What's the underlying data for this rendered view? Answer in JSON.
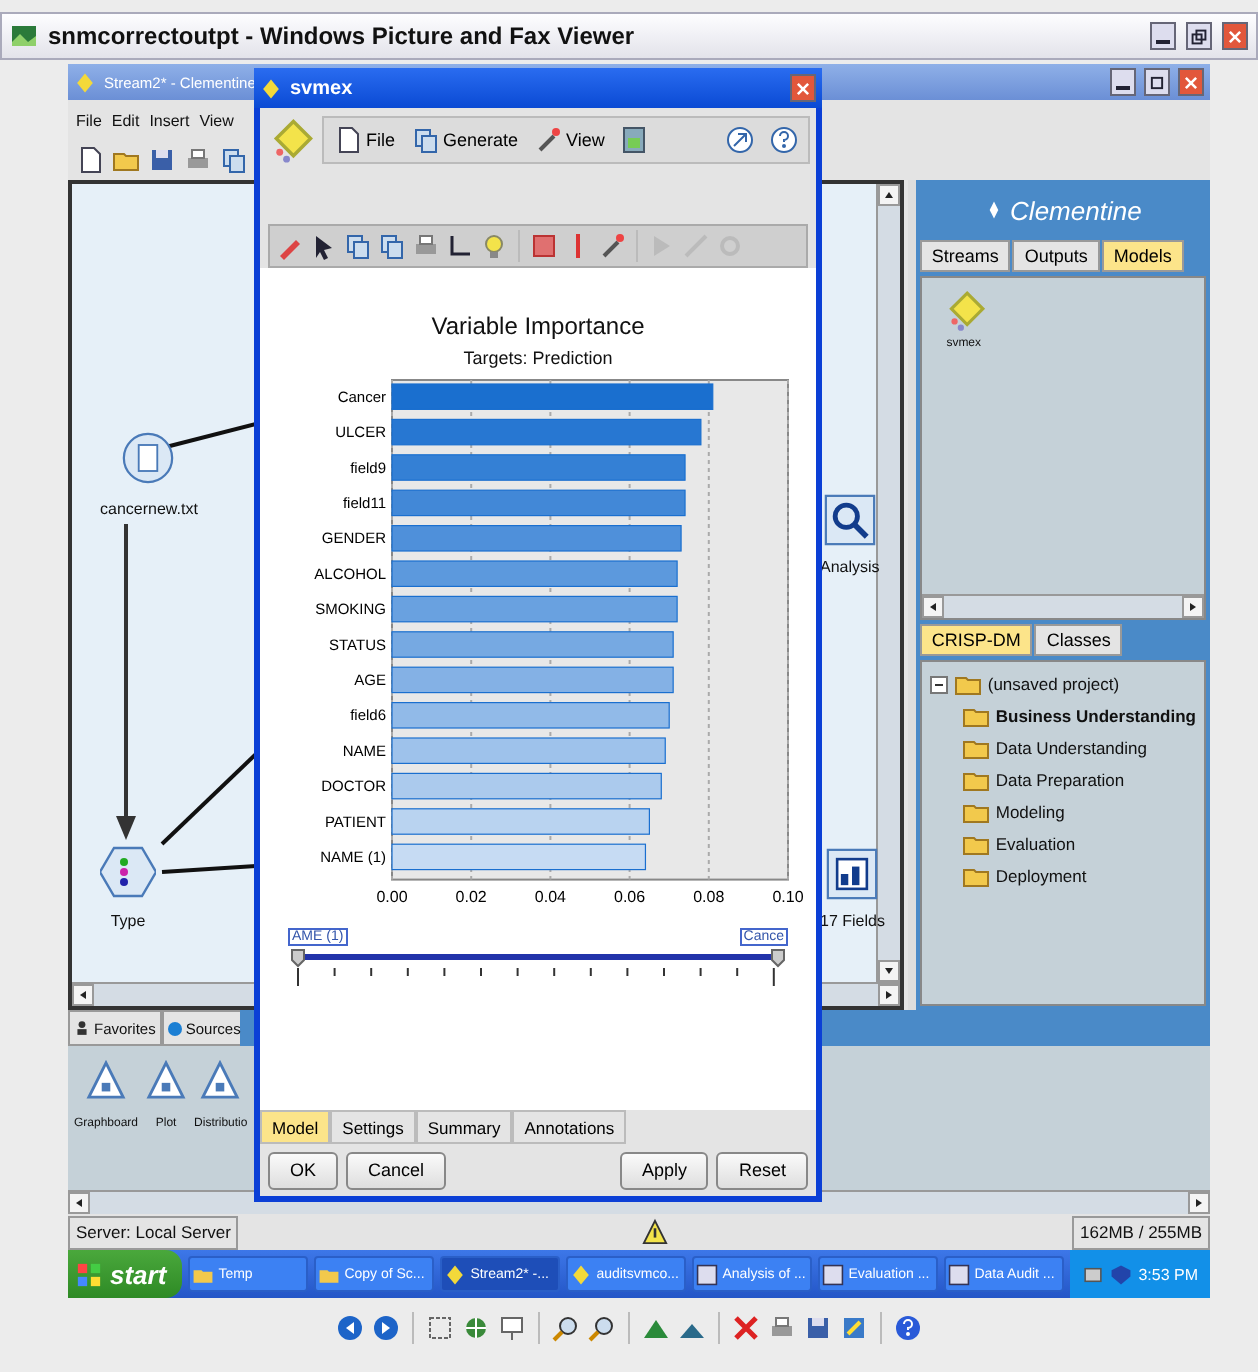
{
  "viewer": {
    "title": "snmcorrectoutpt - Windows Picture and Fax Viewer"
  },
  "app": {
    "title": "Stream2* - Clementine",
    "menu": [
      "File",
      "Edit",
      "Insert",
      "View"
    ]
  },
  "canvas": {
    "nodes": [
      {
        "kind": "file",
        "label": "cancernew.txt"
      },
      {
        "kind": "type",
        "label": "Type"
      },
      {
        "kind": "analysis",
        "label": "Analysis"
      },
      {
        "kind": "audit",
        "label": "17 Fields"
      }
    ]
  },
  "managers": {
    "logo": "Clementine",
    "tabs": [
      {
        "label": "Streams",
        "selected": false
      },
      {
        "label": "Outputs",
        "selected": false
      },
      {
        "label": "Models",
        "selected": true
      }
    ],
    "models": [
      {
        "label": "svmex"
      }
    ]
  },
  "project": {
    "tabs": [
      {
        "label": "CRISP-DM",
        "selected": true
      },
      {
        "label": "Classes",
        "selected": false
      }
    ],
    "tree": {
      "label": "(unsaved project)",
      "expanded": true,
      "children": [
        {
          "label": "Business Understanding",
          "selected": true
        },
        {
          "label": "Data Understanding",
          "selected": false
        },
        {
          "label": "Data Preparation",
          "selected": false
        },
        {
          "label": "Modeling",
          "selected": false
        },
        {
          "label": "Evaluation",
          "selected": false
        },
        {
          "label": "Deployment",
          "selected": false
        }
      ]
    }
  },
  "palette": {
    "tabs": [
      "Favorites",
      "Sources"
    ],
    "items": [
      "Graphboard",
      "Plot",
      "Distributio"
    ]
  },
  "status_bar": {
    "server": "Server: Local Server",
    "memory": "162MB / 255MB"
  },
  "dialog": {
    "title": "svmex",
    "menu": [
      "File",
      "Generate",
      "View"
    ],
    "heading": "Variable Importance",
    "subheading": "Targets: Prediction",
    "chart_data": {
      "type": "bar",
      "orientation": "horizontal",
      "categories": [
        "Cancer",
        "ULCER",
        "field9",
        "field11",
        "GENDER",
        "ALCOHOL",
        "SMOKING",
        "STATUS",
        "AGE",
        "field6",
        "NAME",
        "DOCTOR",
        "PATIENT",
        "NAME (1)"
      ],
      "grid": true,
      "series": [
        {
          "color": "#1a6fcf",
          "values": [
            0.081,
            0.078,
            0.074,
            0.074,
            0.073,
            0.072,
            0.072,
            0.071,
            0.071,
            0.07,
            0.069,
            0.068,
            0.065,
            0.064
          ]
        }
      ],
      "xlim": [
        0,
        0.1
      ],
      "xticks": [
        {
          "value": 0,
          "label": "0.00"
        },
        {
          "value": 0.02,
          "label": "0.02"
        },
        {
          "value": 0.04,
          "label": "0.04"
        },
        {
          "value": 0.06,
          "label": "0.06"
        },
        {
          "value": 0.08,
          "label": "0.08"
        },
        {
          "value": 0.1,
          "label": "0.10"
        }
      ]
    },
    "slider": {
      "low_label": "AME (1)",
      "high_label": "Cance",
      "thumbs": [
        {
          "level": 0
        },
        {
          "level": 1
        }
      ]
    },
    "tabs": [
      {
        "label": "Model",
        "selected": true
      },
      {
        "label": "Settings",
        "selected": false
      },
      {
        "label": "Summary",
        "selected": false
      },
      {
        "label": "Annotations",
        "selected": false
      }
    ],
    "buttons": {
      "left": [
        "OK",
        "Cancel"
      ],
      "right": [
        "Apply",
        "Reset"
      ]
    }
  },
  "taskbar": {
    "start": "start",
    "items": [
      {
        "label": "Temp",
        "kind": "folder",
        "selected": false
      },
      {
        "label": "Copy of Sc...",
        "kind": "folder",
        "selected": false
      },
      {
        "label": "Stream2* -...",
        "kind": "app",
        "selected": true
      },
      {
        "label": "auditsvmco...",
        "kind": "app",
        "selected": false
      },
      {
        "label": "Analysis of ...",
        "kind": "window",
        "selected": false
      },
      {
        "label": "Evaluation ...",
        "kind": "window",
        "selected": false
      },
      {
        "label": "Data Audit ...",
        "kind": "window",
        "selected": false
      }
    ],
    "clock": "3:53 PM"
  }
}
